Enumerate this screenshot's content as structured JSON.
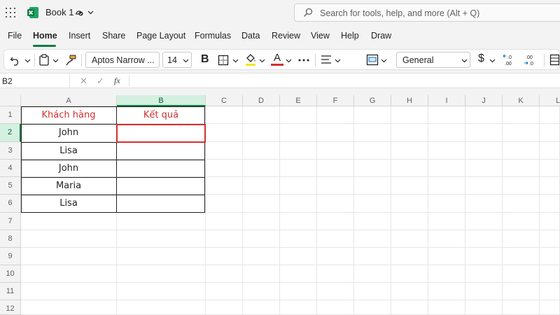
{
  "app": {
    "title": "Book 1",
    "brand_color": "#107c41"
  },
  "search": {
    "placeholder": "Search for tools, help, and more (Alt + Q)"
  },
  "menu": {
    "items": [
      "File",
      "Home",
      "Insert",
      "Share",
      "Page Layout",
      "Formulas",
      "Data",
      "Review",
      "View",
      "Help",
      "Draw"
    ],
    "active": "Home"
  },
  "ribbon": {
    "font_name": "Aptos Narrow ...",
    "font_size": "14",
    "bold_label": "B",
    "font_color_label": "A",
    "number_format": "General",
    "currency_label": "$",
    "fill_color": "#f5e71c",
    "font_color": "#d32f2f",
    "icons": [
      "undo-icon",
      "clipboard-icon",
      "format-painter-icon",
      "borders-icon",
      "fill-color-icon",
      "font-color-icon",
      "more-icon",
      "align-icon",
      "merge-icon",
      "currency-icon",
      "increase-decimal-icon",
      "decrease-decimal-icon"
    ]
  },
  "formula_bar": {
    "name_box": "B2",
    "fx_label": "fx",
    "cancel_label": "✕",
    "enter_label": "✓",
    "value": ""
  },
  "sheet": {
    "columns": [
      "A",
      "B",
      "C",
      "D",
      "E",
      "F",
      "G",
      "H",
      "I",
      "J",
      "K",
      "L"
    ],
    "rows": [
      "1",
      "2",
      "3",
      "4",
      "5",
      "6",
      "7",
      "8",
      "9",
      "10",
      "11",
      "12"
    ],
    "selected_cell": "B2",
    "header_text_color": "#d32f2f",
    "header": {
      "A": "Khách hàng",
      "B": "Kết quả"
    },
    "data": [
      {
        "A": "John",
        "B": ""
      },
      {
        "A": "Lisa",
        "B": ""
      },
      {
        "A": "John",
        "B": ""
      },
      {
        "A": "Maria",
        "B": ""
      },
      {
        "A": "Lisa",
        "B": ""
      }
    ]
  }
}
